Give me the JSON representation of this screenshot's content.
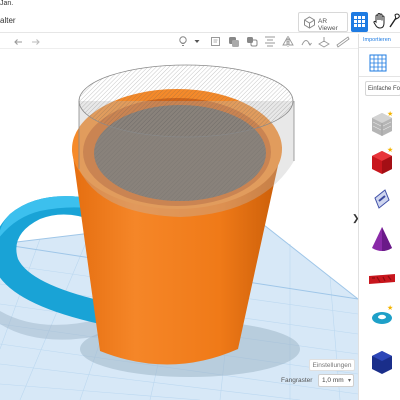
{
  "topstrip": {
    "text": "Jan."
  },
  "title": {
    "name": "alter"
  },
  "header": {
    "ar_viewer_label": "AR Viewer",
    "grid_view_icon": "grid-icon",
    "hand_icon": "hand-icon",
    "tool_icon": "pick-tool-icon"
  },
  "toolbar": {
    "icons": [
      "undo-icon",
      "redo-icon",
      "light-bulb-icon",
      "chevron-down-icon",
      "note-icon",
      "group-icon",
      "ungroup-icon",
      "align-icon",
      "mirror-icon",
      "flip-icon",
      "workplane-icon",
      "ruler-icon"
    ]
  },
  "right_panel": {
    "import_label": "Importieren",
    "shapes_dropdown": "Einfache Formen",
    "shapes": [
      "Box gestreift",
      "Würfel",
      "Kegel/Papierschiff",
      "Kegel",
      "Text",
      "Torus",
      "Würfel blau"
    ],
    "collapse_label": "❯"
  },
  "viewport": {
    "settings_label": "Einstellungen",
    "snap_grid_label": "Fangraster",
    "snap_grid_value": "1,0 mm"
  },
  "colors": {
    "accent": "#1e7be2",
    "cup_orange": "#f07a18",
    "handle_blue": "#19a3d6",
    "grid_blue": "#bcd8f0"
  }
}
